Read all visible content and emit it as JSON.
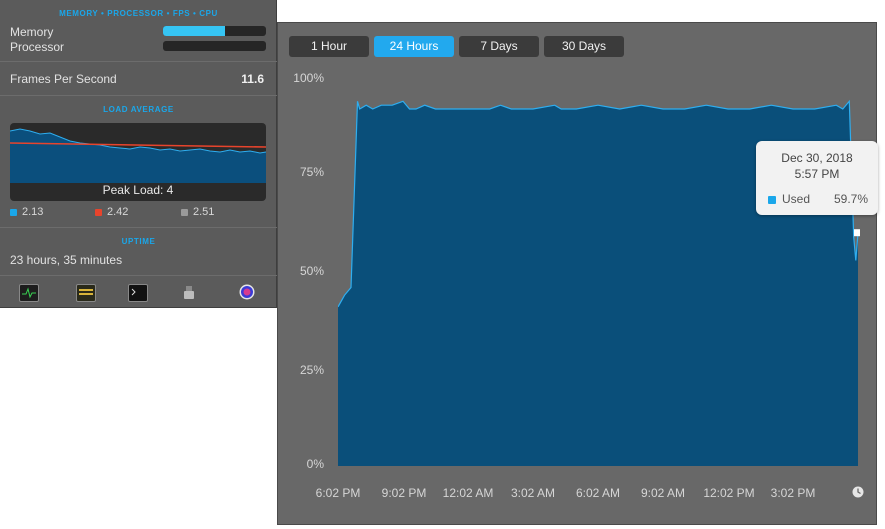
{
  "left_panel": {
    "section_title_memory": "MEMORY • PROCESSOR • FPS • CPU",
    "memory_label": "Memory",
    "memory_fraction": 0.6,
    "processor_label": "Processor",
    "processor_fraction": 0.0,
    "fps_label": "Frames Per Second",
    "fps_value": "11.6",
    "load_title": "LOAD AVERAGE",
    "peak_load": "Peak Load: 4",
    "load_legend": [
      {
        "value": "2.13",
        "color": "#1aa7ea"
      },
      {
        "value": "2.42",
        "color": "#e8442c"
      },
      {
        "value": "2.51",
        "color": "#9a9a9a"
      }
    ],
    "uptime_title": "UPTIME",
    "uptime_value": "23 hours, 35 minutes",
    "dock_icons": [
      "activity-monitor-icon",
      "console-icon",
      "terminal-icon",
      "disk-utility-icon",
      "istat-menus-icon"
    ]
  },
  "graph": {
    "tabs": [
      {
        "label": "1 Hour",
        "active": false
      },
      {
        "label": "24 Hours",
        "active": true
      },
      {
        "label": "7 Days",
        "active": false
      },
      {
        "label": "30 Days",
        "active": false
      }
    ],
    "tooltip": {
      "date": "Dec 30, 2018",
      "time": "5:57 PM",
      "series": "Used",
      "value": "59.7%"
    },
    "series_color": "#0a4f7a",
    "line_color": "#2eaef0"
  },
  "chart_data": {
    "type": "area",
    "title": "",
    "xlabel": "",
    "ylabel": "",
    "ylim": [
      0,
      100
    ],
    "yticks": [
      "0%",
      "25%",
      "50%",
      "75%",
      "100%"
    ],
    "xticks": [
      "6:02 PM",
      "9:02 PM",
      "12:02 AM",
      "3:02 AM",
      "6:02 AM",
      "9:02 AM",
      "12:02 PM",
      "3:02 PM"
    ],
    "series": [
      {
        "name": "Used",
        "x_hours": [
          0,
          0.3,
          0.6,
          0.9,
          1.0,
          1.3,
          1.6,
          2.0,
          2.5,
          3.0,
          3.3,
          3.6,
          4.0,
          4.5,
          5.0,
          6.0,
          7.0,
          7.5,
          8.0,
          9.0,
          10.0,
          10.3,
          11.0,
          12.0,
          13.0,
          14.0,
          15.0,
          16.0,
          17.0,
          18.0,
          19.0,
          20.0,
          21.0,
          22.0,
          23.0,
          23.3,
          23.6,
          23.8,
          23.9,
          24.0
        ],
        "values": [
          41,
          44,
          46,
          94,
          92,
          93,
          92,
          93,
          93,
          94,
          92,
          92,
          93,
          92,
          92,
          92,
          92,
          93,
          92,
          92,
          93,
          92,
          92,
          93,
          92,
          93,
          92,
          92,
          93,
          92,
          92,
          93,
          92,
          92,
          93,
          92,
          94,
          59,
          53,
          60
        ]
      }
    ]
  }
}
